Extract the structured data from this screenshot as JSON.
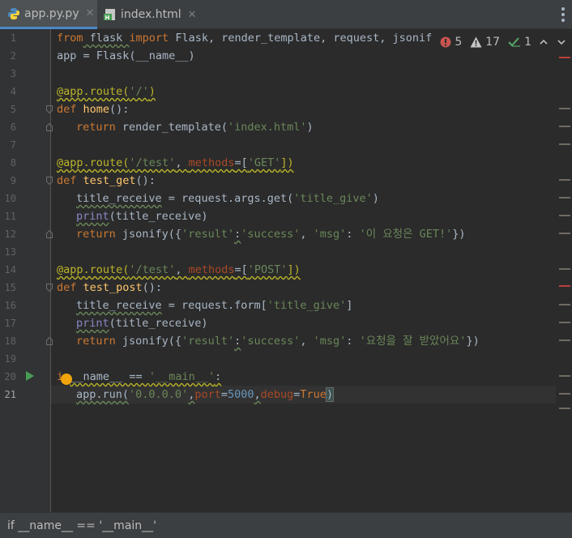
{
  "tabs": [
    {
      "label": "app.py.py",
      "icon": "python-file-icon",
      "active": true
    },
    {
      "label": "index.html",
      "icon": "html-file-icon",
      "active": false
    }
  ],
  "inspections": {
    "errors": "5",
    "warnings": "17",
    "weak_warnings": "1"
  },
  "line_numbers": [
    "1",
    "2",
    "3",
    "4",
    "5",
    "6",
    "7",
    "8",
    "9",
    "10",
    "11",
    "12",
    "13",
    "14",
    "15",
    "16",
    "17",
    "18",
    "19",
    "20",
    "21"
  ],
  "code": {
    "l1": {
      "kw1": "from",
      "mod": " flask ",
      "kw2": "import",
      "rest": " Flask, render_template, request, jsonif"
    },
    "l2": "app = Flask(__name__)",
    "l4": {
      "dec": "@app.route(",
      "str": "'/'",
      "close": ")"
    },
    "l5": {
      "kw": "def ",
      "fn": "home",
      "rest": "():"
    },
    "l6": {
      "kw": "return",
      "mid": " render_template(",
      "str": "'index.html'",
      "close": ")"
    },
    "l8": {
      "dec": "@app.route(",
      "str": "'/test'",
      "comma": ", ",
      "param": "methods",
      "eq": "=[",
      "str2": "'GET'",
      "close": "])"
    },
    "l9": {
      "kw": "def ",
      "fn": "test_get",
      "rest": "():"
    },
    "l10": {
      "var": "title_receive",
      "mid": " = request.args.get(",
      "str": "'title_give'",
      "close": ")"
    },
    "l11": {
      "fn": "print",
      "rest": "(title_receive)"
    },
    "l12": {
      "kw": "return",
      "mid": " jsonify({",
      "s1": "'result'",
      "c1": ":",
      "s2": "'success'",
      "c2": ", ",
      "s3": "'msg'",
      "c3": ": ",
      "s4": "'이 요청은 GET!'",
      "close": "})"
    },
    "l14": {
      "dec": "@app.route(",
      "str": "'/test'",
      "comma": ", ",
      "param": "methods",
      "eq": "=[",
      "str2": "'POST'",
      "close": "])"
    },
    "l15": {
      "kw": "def ",
      "fn": "test_post",
      "rest": "():"
    },
    "l16": {
      "var": "title_receive",
      "mid": " = request.form[",
      "str": "'title_give'",
      "close": "]"
    },
    "l17": {
      "fn": "print",
      "rest": "(title_receive)"
    },
    "l18": {
      "kw": "return",
      "mid": " jsonify({",
      "s1": "'result'",
      "c1": ":",
      "s2": "'success'",
      "c2": ", ",
      "s3": "'msg'",
      "c3": ": ",
      "s4": "'요청을 잘 받았어요'",
      "close": "})"
    },
    "l20": {
      "kw": "i",
      "kw2": "f",
      "rest": "__name__ == ",
      "str": "'__main__'",
      "colon": ":"
    },
    "l21": {
      "a": "app.run(",
      "s1": "'0.0.0.0'",
      "c1": ",",
      "p1": "port",
      "e1": "=",
      "n1": "5000",
      "c2": ",",
      "p2": "debug",
      "e2": "=",
      "k": "True",
      "close": ")"
    }
  },
  "status": {
    "breadcrumb": "if __name__ == '__main__'"
  },
  "colors": {
    "keyword": "#cc7832",
    "string": "#6a8759",
    "decorator": "#bbb529",
    "function": "#ffc66d",
    "number": "#6897bb",
    "background": "#2b2b2b"
  }
}
